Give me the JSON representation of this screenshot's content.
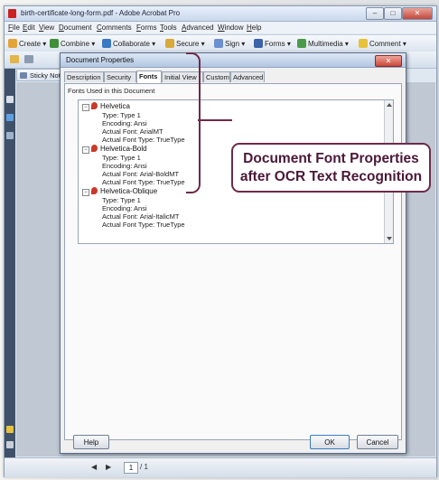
{
  "window": {
    "title": "birth-certificate-long-form.pdf - Adobe Acrobat Pro",
    "controls": {
      "minimize": "–",
      "maximize": "□",
      "close": "✕"
    }
  },
  "menubar": [
    "File",
    "Edit",
    "View",
    "Document",
    "Comments",
    "Forms",
    "Tools",
    "Advanced",
    "Window",
    "Help"
  ],
  "toolbar": [
    {
      "label": "Create",
      "icon": "create-icon",
      "color": "#e3a437"
    },
    {
      "label": "Combine",
      "icon": "combine-icon",
      "color": "#3f8f3a"
    },
    {
      "label": "Collaborate",
      "icon": "collaborate-icon",
      "color": "#3a78c5"
    },
    {
      "label": "Secure",
      "icon": "secure-icon",
      "color": "#d9a93a"
    },
    {
      "label": "Sign",
      "icon": "sign-icon",
      "color": "#6b8fd0"
    },
    {
      "label": "Forms",
      "icon": "forms-icon",
      "color": "#3d62a8"
    },
    {
      "label": "Multimedia",
      "icon": "multimedia-icon",
      "color": "#4a9a4a"
    },
    {
      "label": "Comment",
      "icon": "comment-icon",
      "color": "#e8c23a"
    }
  ],
  "sidebar": {
    "sticky_note": "Sticky Note"
  },
  "status": {
    "page_current": "1",
    "page_total": "/ 1"
  },
  "dialog": {
    "title": "Document Properties",
    "close": "✕",
    "tabs": [
      "Description",
      "Security",
      "Fonts",
      "Initial View",
      "Custom",
      "Advanced"
    ],
    "active_tab": "Fonts",
    "caption": "Fonts Used in this Document",
    "fonts": [
      {
        "name": "Helvetica",
        "type": "Type: Type 1",
        "encoding": "Encoding: Ansi",
        "actual_font": "Actual Font: ArialMT",
        "actual_type": "Actual Font Type: TrueType"
      },
      {
        "name": "Helvetica-Bold",
        "type": "Type: Type 1",
        "encoding": "Encoding: Ansi",
        "actual_font": "Actual Font: Arial-BoldMT",
        "actual_type": "Actual Font Type: TrueType"
      },
      {
        "name": "Helvetica-Oblique",
        "type": "Type: Type 1",
        "encoding": "Encoding: Ansi",
        "actual_font": "Actual Font: Arial-ItalicMT",
        "actual_type": "Actual Font Type: TrueType"
      }
    ],
    "help_button": "Help",
    "ok_button": "OK",
    "cancel_button": "Cancel"
  },
  "annotation": {
    "line1": "Document Font Properties",
    "line2": "after OCR Text Recognition",
    "color": "#6c2b4a"
  }
}
